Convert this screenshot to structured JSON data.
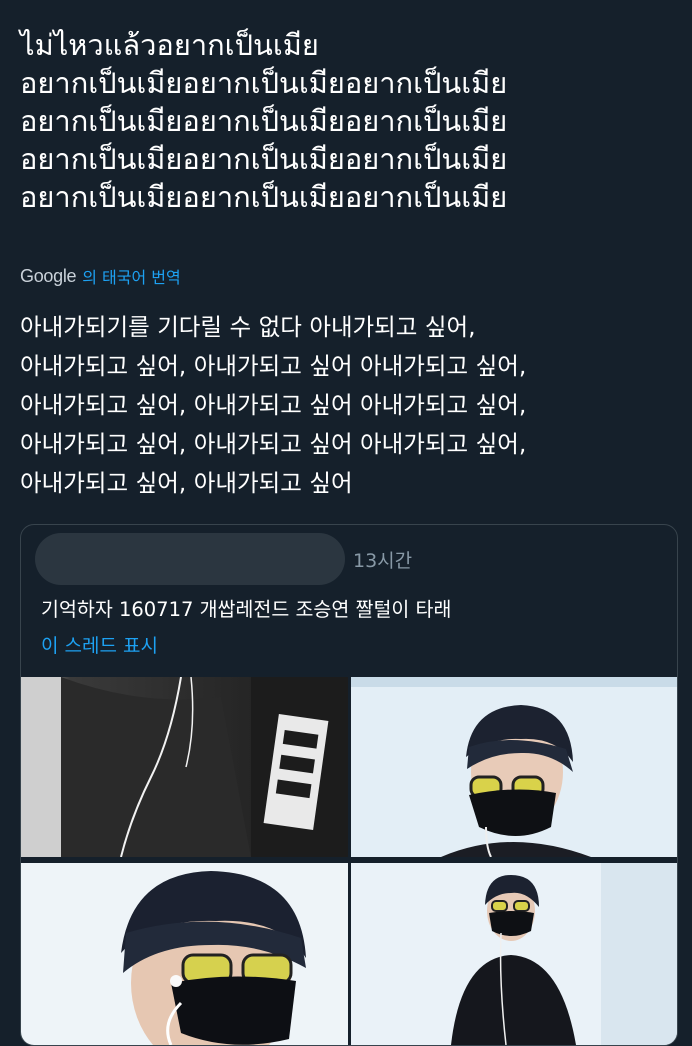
{
  "tweet": {
    "thai_lines": [
      "ไม่ไหวแล้วอยากเป็นเมีย",
      "อยากเป็นเมียอยากเป็นเมียอยากเป็นเมีย",
      "อยากเป็นเมียอยากเป็นเมียอยากเป็นเมีย",
      "อยากเป็นเมียอยากเป็นเมียอยากเป็นเมีย",
      "อยากเป็นเมียอยากเป็นเมียอยากเป็นเมีย"
    ],
    "translate_provider": "Google",
    "translate_label": "의 태국어 번역",
    "translation_lines": [
      "아내가되기를 기다릴 수 없다 아내가되고 싶어,",
      "아내가되고 싶어, 아내가되고 싶어 아내가되고 싶어,",
      "아내가되고 싶어, 아내가되고 싶어 아내가되고 싶어,",
      "아내가되고 싶어, 아내가되고 싶어 아내가되고 싶어,",
      "아내가되고 싶어, 아내가되고 싶어"
    ]
  },
  "quoted_tweet": {
    "time": "13시간",
    "text": "기억하자 160717 개쌉레전드 조승연 짤털이 타래",
    "thread_link": "이 스레드 표시"
  },
  "colors": {
    "background": "#15202b",
    "text": "#ffffff",
    "accent": "#1da1f2",
    "muted": "#8899a6",
    "border": "#38444d"
  }
}
